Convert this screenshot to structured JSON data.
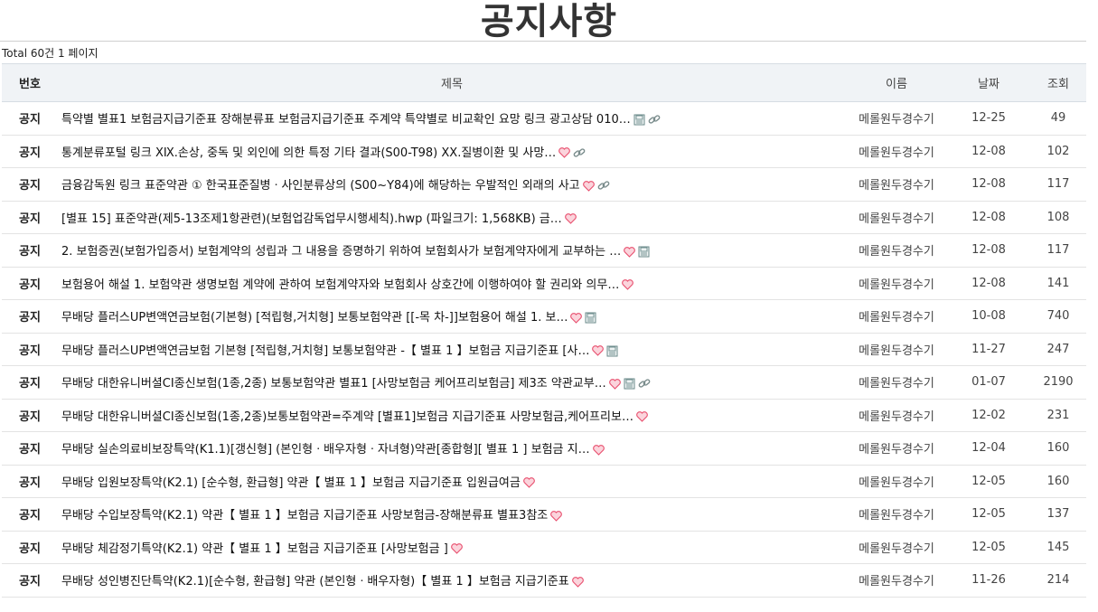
{
  "page": {
    "title": "공지사항",
    "total": "Total 60건 1 페이지"
  },
  "table": {
    "headers": {
      "num": "번호",
      "subject": "제목",
      "name": "이름",
      "date": "날짜",
      "hits": "조회"
    },
    "rows": [
      {
        "num": "공지",
        "subject": "특약별 별표1 보험금지급기준표 장해분류표 보험금지급기준표 주계약 특약별로 비교확인 요망 링크 광고상담 010…",
        "icons": [
          "file",
          "link"
        ],
        "name": "메롤원두경수기",
        "date": "12-25",
        "hits": "49"
      },
      {
        "num": "공지",
        "subject": "통계분류포털 링크 ⅩⅨ.손상, 중독 및 외인에 의한 특정 기타 결과(S00-T98) ⅩⅩ.질병이환 및 사망…",
        "icons": [
          "heart",
          "link"
        ],
        "name": "메롤원두경수기",
        "date": "12-08",
        "hits": "102"
      },
      {
        "num": "공지",
        "subject": "금융감독원 링크 표준약관 ① 한국표준질병ㆍ사인분류상의 (S00~Y84)에 해당하는 우발적인 외래의 사고",
        "icons": [
          "heart",
          "link"
        ],
        "name": "메롤원두경수기",
        "date": "12-08",
        "hits": "117"
      },
      {
        "num": "공지",
        "subject": "[별표 15] 표준약관(제5-13조제1항관련)(보험업감독업무시행세칙).hwp (파일크기: 1,568KB) 금…",
        "icons": [
          "heart"
        ],
        "name": "메롤원두경수기",
        "date": "12-08",
        "hits": "108"
      },
      {
        "num": "공지",
        "subject": "2. 보험증권(보험가입증서) 보험계약의 성립과 그 내용을 증명하기 위하여 보험회사가 보험계약자에게 교부하는 …",
        "icons": [
          "heart",
          "file"
        ],
        "name": "메롤원두경수기",
        "date": "12-08",
        "hits": "117"
      },
      {
        "num": "공지",
        "subject": "보험용어 해설 1. 보험약관 생명보험 계약에 관하여 보험계약자와 보험회사 상호간에 이행하여야 할 권리와 의무…",
        "icons": [
          "heart"
        ],
        "name": "메롤원두경수기",
        "date": "12-08",
        "hits": "141"
      },
      {
        "num": "공지",
        "subject": "무배당 플러스UP변액연금보험(기본형) [적립형,거치형] 보통보험약관 [[-목 차-]]보험용어 해설 1. 보…",
        "icons": [
          "heart",
          "file"
        ],
        "name": "메롤원두경수기",
        "date": "10-08",
        "hits": "740"
      },
      {
        "num": "공지",
        "subject": "무배당 플러스UP변액연금보험 기본형 [적립형,거치형] 보통보험약관 -【 별표 1 】보험금 지급기준표 [사…",
        "icons": [
          "heart",
          "file"
        ],
        "name": "메롤원두경수기",
        "date": "11-27",
        "hits": "247"
      },
      {
        "num": "공지",
        "subject": "무배당 대한유니버셜CI종신보험(1종,2종) 보통보험약관 별표1 [사망보험금 케어프리보험금] 제3조 약관교부…",
        "icons": [
          "heart",
          "file",
          "link"
        ],
        "name": "메롤원두경수기",
        "date": "01-07",
        "hits": "2190"
      },
      {
        "num": "공지",
        "subject": "무배당 대한유니버셜CI종신보험(1종,2종)보통보험약관=주계약 [별표1]보험금 지급기준표 사망보험금,케어프리보…",
        "icons": [
          "heart"
        ],
        "name": "메롤원두경수기",
        "date": "12-02",
        "hits": "231"
      },
      {
        "num": "공지",
        "subject": "무배당 실손의료비보장특약(K1.1)[갱신형] (본인형ㆍ배우자형ㆍ자녀형)약관[종합형][ 별표 1 ] 보험금 지…",
        "icons": [
          "heart"
        ],
        "name": "메롤원두경수기",
        "date": "12-04",
        "hits": "160"
      },
      {
        "num": "공지",
        "subject": "무배당 입원보장특약(K2.1) [순수형, 환급형] 약관【 별표 1 】보험금 지급기준표 입원급여금",
        "icons": [
          "heart"
        ],
        "name": "메롤원두경수기",
        "date": "12-05",
        "hits": "160"
      },
      {
        "num": "공지",
        "subject": "무배당 수입보장특약(K2.1) 약관【 별표 1 】보험금 지급기준표 사망보험금-장해분류표 별표3참조",
        "icons": [
          "heart"
        ],
        "name": "메롤원두경수기",
        "date": "12-05",
        "hits": "137"
      },
      {
        "num": "공지",
        "subject": "무배당 체감정기특약(K2.1) 약관【 별표 1 】보험금 지급기준표 [사망보험금 ]",
        "icons": [
          "heart"
        ],
        "name": "메롤원두경수기",
        "date": "12-05",
        "hits": "145"
      },
      {
        "num": "공지",
        "subject": "무배당 성인병진단특약(K2.1)[순수형, 환급형] 약관 (본인형ㆍ배우자형)【 별표 1 】보험금 지급기준표",
        "icons": [
          "heart"
        ],
        "name": "메롤원두경수기",
        "date": "11-26",
        "hits": "214"
      }
    ]
  },
  "icon_colors": {
    "heart": "#e8506f",
    "file": "#6a8a8a",
    "link": "#7a8c8c"
  }
}
